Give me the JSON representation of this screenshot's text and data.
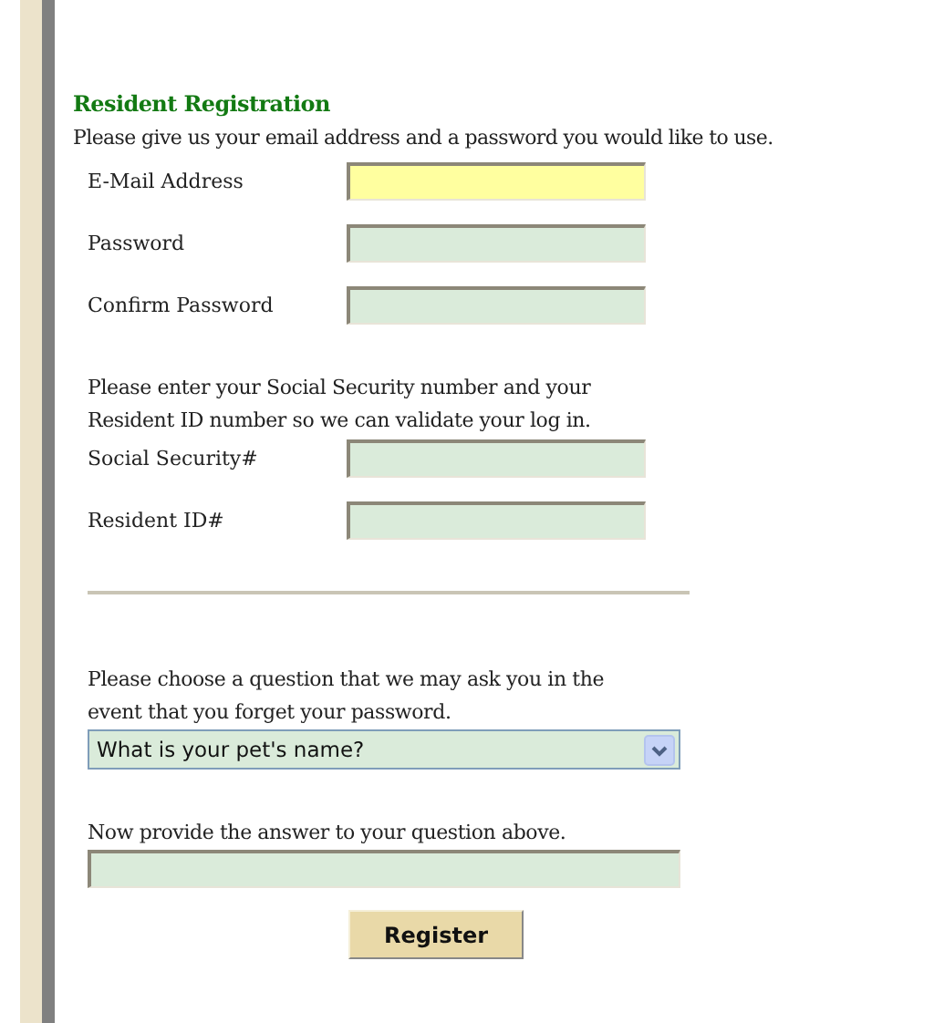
{
  "heading": "Resident Registration",
  "intro": "Please give us your email address and a password you would like to use.",
  "account_fields": [
    {
      "label": "E-Mail Address",
      "focused": true
    },
    {
      "label": "Password",
      "focused": false
    },
    {
      "label": "Confirm Password",
      "focused": false
    }
  ],
  "validation_text": "Please enter your Social Security number and your Resident ID number so we can validate your log in.",
  "id_fields": [
    {
      "label": "Social Security#",
      "focused": false
    },
    {
      "label": "Resident ID#",
      "focused": false
    }
  ],
  "question_text": "Please choose a question that we may ask you in the event that you forget your password.",
  "question_select": {
    "value": "What is your pet's name?"
  },
  "answer_text": "Now provide the answer to your question above.",
  "answer_field": {
    "focused": false
  },
  "register_button": "Register"
}
